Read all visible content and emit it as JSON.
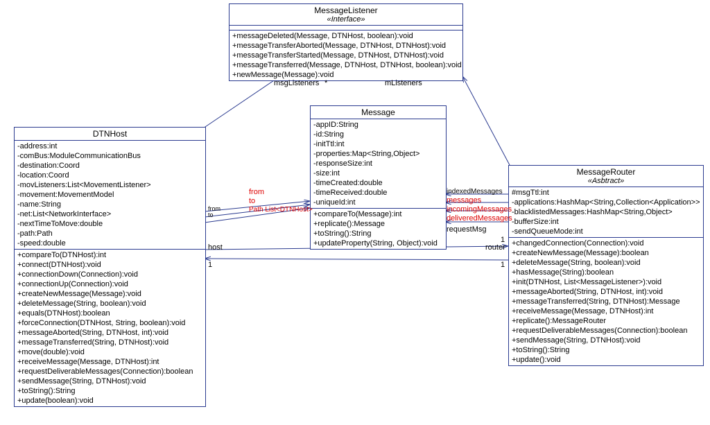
{
  "classes": {
    "listener": {
      "name": "MessageListener",
      "stereo": "«Interface»",
      "ops": [
        "+messageDeleted(Message, DTNHost, boolean):void",
        "+messageTransferAborted(Message, DTNHost, DTNHost):void",
        "+messageTransferStarted(Message, DTNHost, DTNHost):void",
        "+messageTransferred(Message, DTNHost, DTNHost, boolean):void",
        "+newMessage(Message):void"
      ]
    },
    "dtnhost": {
      "name": "DTNHost",
      "attrs": [
        "-address:int",
        "-comBus:ModuleCommunicationBus",
        "-destination:Coord",
        "-location:Coord",
        "-movListeners:List<MovementListener>",
        "-movement:MovementModel",
        "-name:String",
        "-net:List<NetworkInterface>",
        "-nextTimeToMove:double",
        "-path:Path",
        "-speed:double"
      ],
      "ops": [
        "+compareTo(DTNHost):int",
        "+connect(DTNHost):void",
        "+connectionDown(Connection):void",
        "+connectionUp(Connection):void",
        "+createNewMessage(Message):void",
        "+deleteMessage(String, boolean):void",
        "+equals(DTNHost):boolean",
        "+forceConnection(DTNHost, String, boolean):void",
        "+messageAborted(String, DTNHost, int):void",
        "+messageTransferred(String, DTNHost):void",
        "+move(double):void",
        "+receiveMessage(Message, DTNHost):int",
        "+requestDeliverableMessages(Connection):boolean",
        "+sendMessage(String, DTNHost):void",
        "+toString():String",
        "+update(boolean):void"
      ]
    },
    "message": {
      "name": "Message",
      "attrs": [
        "-appID:String",
        "-id:String",
        "-initTtl:int",
        "-properties:Map<String,Object>",
        "-responseSize:int",
        "-size:int",
        "-timeCreated:double",
        "-timeReceived:double",
        "-uniqueId:int"
      ],
      "ops": [
        "+compareTo(Message):int",
        "+replicate():Message",
        "+toString():String",
        "+updateProperty(String, Object):void"
      ]
    },
    "router": {
      "name": "MessageRouter",
      "stereo": "«Asbtract»",
      "attrs": [
        "#msgTtl:int",
        "-applications:HashMap<String,Collection<Application>>",
        "-blacklistedMessages:HashMap<String,Object>",
        "-bufferSize:int",
        "-sendQueueMode:int"
      ],
      "ops": [
        "+changedConnection(Connection):void",
        "+createNewMessage(Message):boolean",
        "+deleteMessage(String, boolean):void",
        "+hasMessage(String):boolean",
        "+init(DTNHost, List<MessageListener>):void",
        "+messageAborted(String, DTNHost, int):void",
        "+messageTransferred(String, DTNHost):Message",
        "+receiveMessage(Message, DTNHost):int",
        "+replicate():MessageRouter",
        "+requestDeliverableMessages(Connection):boolean",
        "+sendMessage(String, DTNHost):void",
        "+toString():String",
        "+update():void"
      ]
    }
  },
  "labels": {
    "msgListeners": "msgListeners",
    "star1": "*",
    "mListeners": "mListeners",
    "from": "from",
    "to": "to",
    "path": "Path List<DTNHost>",
    "host": "host",
    "one1": "1",
    "one2": "1",
    "router": "router",
    "one3": "1",
    "one4": "1",
    "messages": "messages",
    "incoming": "incomingMessages",
    "delivered": "deliveredMessages",
    "requestMsg": "requestMsg",
    "overlap": "indexedMessages",
    "fromto_stack": "from\nto"
  }
}
